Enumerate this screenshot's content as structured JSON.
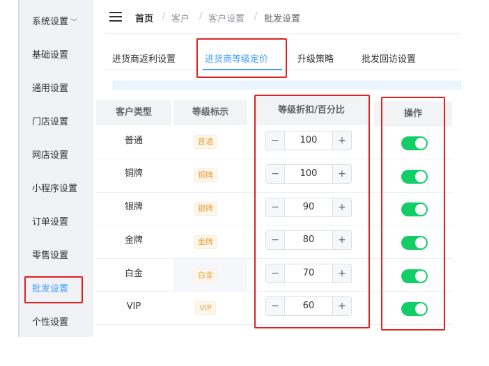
{
  "sidebar": {
    "items": [
      {
        "label": "系统设置"
      },
      {
        "label": "基础设置"
      },
      {
        "label": "通用设置"
      },
      {
        "label": "门店设置"
      },
      {
        "label": "网店设置"
      },
      {
        "label": "小程序设置"
      },
      {
        "label": "订单设置"
      },
      {
        "label": "零售设置"
      },
      {
        "label": "批发设置"
      },
      {
        "label": "个性设置"
      }
    ]
  },
  "breadcrumb": {
    "home": "首页",
    "sep": "/",
    "items": [
      "客户",
      "客户设置",
      "批发设置"
    ]
  },
  "tabs": [
    {
      "label": "进货商返利设置"
    },
    {
      "label": "进货商等级定价"
    },
    {
      "label": "升级策略"
    },
    {
      "label": "批发回访设置"
    }
  ],
  "table": {
    "headers": {
      "type": "客户类型",
      "badge": "等级标示",
      "discount": "等级折扣/百分比",
      "action": "操作"
    },
    "rows": [
      {
        "type": "普通",
        "badge": "普通",
        "discount": "100",
        "enabled": true
      },
      {
        "type": "铜牌",
        "badge": "铜牌",
        "discount": "100",
        "enabled": true
      },
      {
        "type": "银牌",
        "badge": "银牌",
        "discount": "90",
        "enabled": true
      },
      {
        "type": "金牌",
        "badge": "金牌",
        "discount": "80",
        "enabled": true
      },
      {
        "type": "白金",
        "badge": "白金",
        "discount": "70",
        "enabled": true
      },
      {
        "type": "VIP",
        "badge": "VIP",
        "discount": "60",
        "enabled": true
      }
    ],
    "minus": "−",
    "plus": "+"
  },
  "colors": {
    "accent": "#409eff",
    "highlight": "#e02020",
    "toggle_on": "#13ce66",
    "badge_text": "#e6a23c"
  }
}
